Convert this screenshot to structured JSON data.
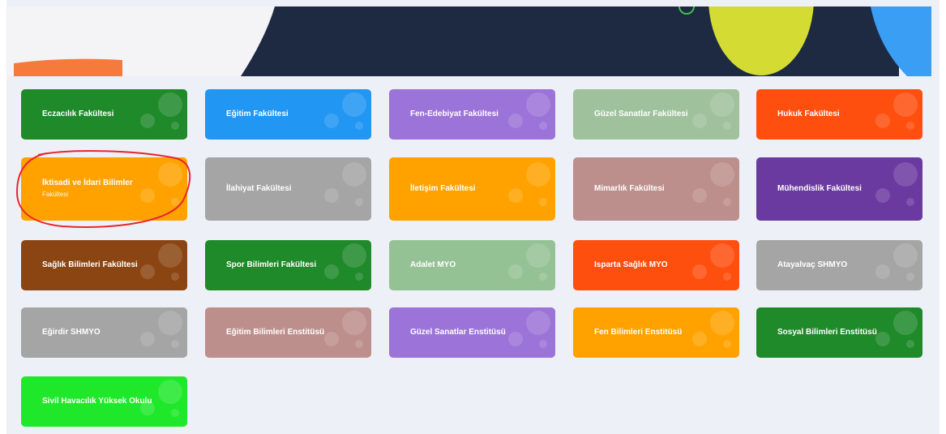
{
  "colors": {
    "background": "#eef0f7",
    "hero_navy": "#1e2942",
    "hero_yellow": "#d4dc34",
    "hero_blue": "#3a9ef5",
    "hero_orange": "#f57a3c",
    "highlight_annotation": "#e8262c"
  },
  "tiles": [
    {
      "label": "Eczacılık Fakültesi",
      "color": "#1f8a2a"
    },
    {
      "label": "Eğitim Fakültesi",
      "color": "#2196f3"
    },
    {
      "label": "Fen-Edebiyat Fakültesi",
      "color": "#9c73d8"
    },
    {
      "label": "Güzel Sanatlar Fakültesi",
      "color": "#9fc29c"
    },
    {
      "label": "Hukuk Fakültesi",
      "color": "#ff4f0f"
    },
    {
      "label": "İktisadi ve İdari Bilimler",
      "sublabel": "Fakültesi",
      "color": "#ffa200",
      "highlighted": true
    },
    {
      "label": "İlahiyat Fakültesi",
      "color": "#a5a5a5"
    },
    {
      "label": "İletişim Fakültesi",
      "color": "#ffa200"
    },
    {
      "label": "Mimarlık Fakültesi",
      "color": "#bd8f8c"
    },
    {
      "label": "Mühendislik Fakültesi",
      "color": "#6a3aa0"
    },
    {
      "label": "Sağlık Bilimleri Fakültesi",
      "color": "#8b4513"
    },
    {
      "label": "Spor Bilimleri Fakültesi",
      "color": "#1f8a2a"
    },
    {
      "label": "Adalet MYO",
      "color": "#95c295"
    },
    {
      "label": "Isparta Sağlık MYO",
      "color": "#ff4f0f"
    },
    {
      "label": "Atayalvaç SHMYO",
      "color": "#a5a5a5"
    },
    {
      "label": "Eğirdir SHMYO",
      "color": "#a5a5a5"
    },
    {
      "label": "Eğitim Bilimleri Enstitüsü",
      "color": "#bd8f8c"
    },
    {
      "label": "Güzel Sanatlar Enstitüsü",
      "color": "#9c73d8"
    },
    {
      "label": "Fen Bilimleri Enstitüsü",
      "color": "#ffa200"
    },
    {
      "label": "Sosyal Bilimleri Enstitüsü",
      "color": "#1f8a2a"
    },
    {
      "label": "Sivil Havacılık Yüksek Okulu",
      "color": "#1fe82a"
    }
  ]
}
